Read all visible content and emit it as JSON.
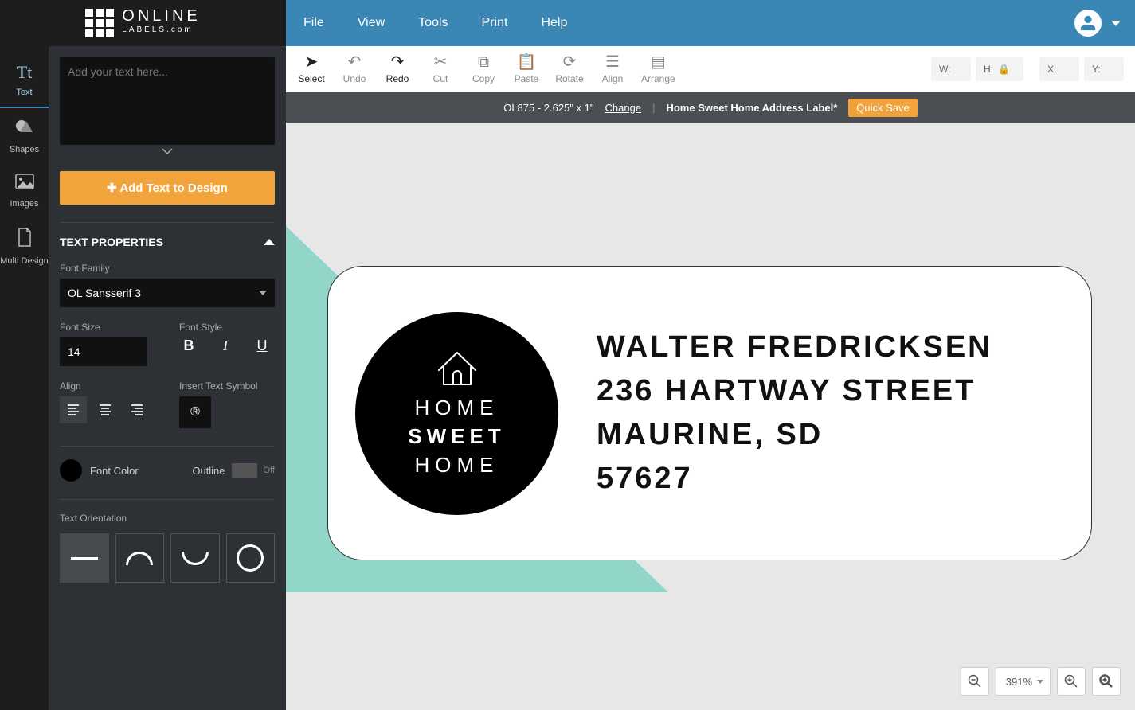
{
  "menu": {
    "file": "File",
    "view": "View",
    "tools": "Tools",
    "print": "Print",
    "help": "Help"
  },
  "rail": {
    "text": "Text",
    "shapes": "Shapes",
    "images": "Images",
    "multi": "Multi Design"
  },
  "panel": {
    "placeholder": "Add your text here...",
    "add_text": "Add Text to Design",
    "section_title": "TEXT PROPERTIES",
    "font_family_label": "Font Family",
    "font_family_value": "OL Sansserif 3",
    "font_size_label": "Font Size",
    "font_size_value": "14",
    "font_style_label": "Font Style",
    "align_label": "Align",
    "insert_symbol_label": "Insert Text Symbol",
    "symbol_glyph": "®",
    "font_color_label": "Font Color",
    "outline_label": "Outline",
    "outline_state": "Off",
    "orientation_label": "Text Orientation"
  },
  "tools": {
    "select": "Select",
    "undo": "Undo",
    "redo": "Redo",
    "cut": "Cut",
    "copy": "Copy",
    "paste": "Paste",
    "rotate": "Rotate",
    "align": "Align",
    "arrange": "Arrange"
  },
  "dims": {
    "w": "W:",
    "h": "H:",
    "x": "X:",
    "y": "Y:"
  },
  "strip": {
    "product": "OL875 - 2.625\" x 1\"",
    "change": "Change",
    "doc_name": "Home Sweet Home Address Label*",
    "quick_save": "Quick Save"
  },
  "label": {
    "home1": "HOME",
    "sweet": "SWEET",
    "home2": "HOME",
    "line1": "WALTER FREDRICKSEN",
    "line2": "236 HARTWAY STREET",
    "line3": "MAURINE, SD",
    "line4": "57627"
  },
  "zoom": {
    "pct": "391%"
  }
}
